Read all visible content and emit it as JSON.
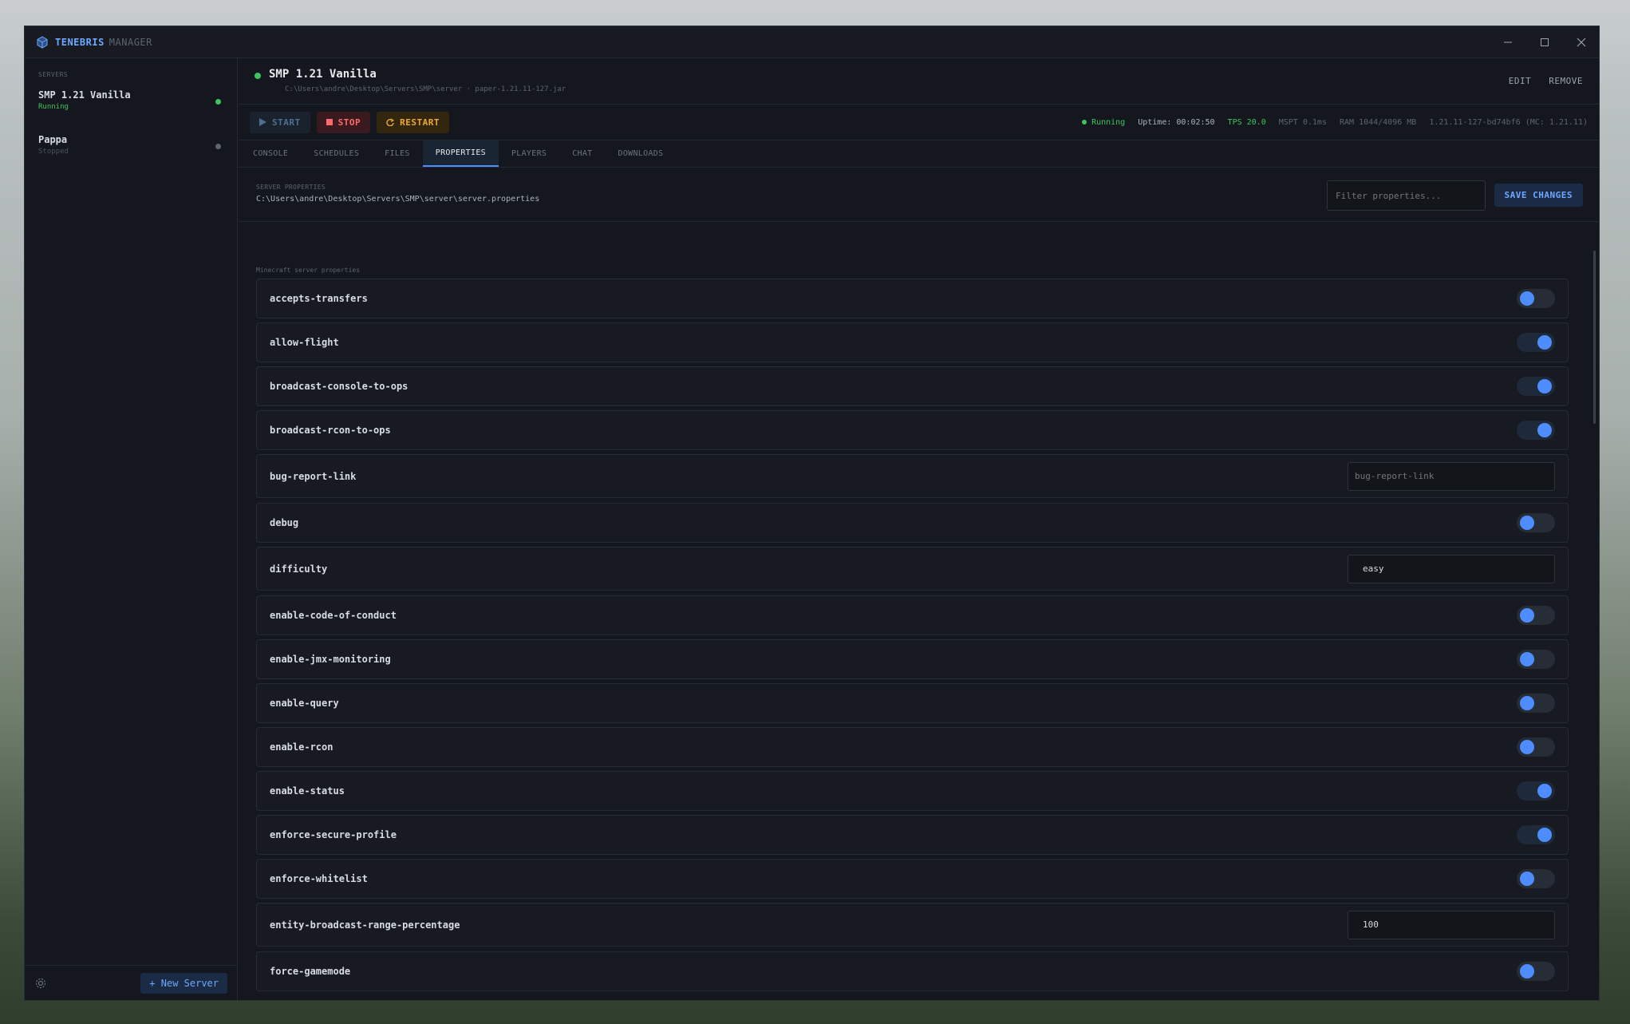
{
  "app": {
    "name": "TENEBRIS",
    "subtitle": "MANAGER"
  },
  "colors": {
    "accent": "#4e8dff",
    "running": "#3ec45f",
    "stopped": "#6b737e",
    "stop": "#ff6a6a",
    "restart": "#f0a830"
  },
  "sidebar": {
    "label": "SERVERS",
    "servers": [
      {
        "name": "SMP 1.21 Vanilla",
        "status": "Running",
        "status_color": "#3ec45f"
      },
      {
        "name": "Pappa",
        "status": "Stopped",
        "status_color": "#5c6470"
      }
    ],
    "new_server_label": "+ New Server"
  },
  "header": {
    "title": "SMP 1.21 Vanilla",
    "path": "C:\\Users\\andre\\Desktop\\Servers\\SMP\\server  ·  paper-1.21.11-127.jar",
    "edit_label": "EDIT",
    "remove_label": "REMOVE"
  },
  "controls": {
    "start_label": "START",
    "stop_label": "STOP",
    "restart_label": "RESTART",
    "status": "Running",
    "uptime": "Uptime: 00:02:50",
    "tps_label": "TPS",
    "tps_value": "20.0",
    "mspt_label": "MSPT",
    "mspt_value": "0.1ms",
    "ram_label": "RAM",
    "ram_value": "1044/4096 MB",
    "version": "1.21.11-127-bd74bf6 (MC: 1.21.11)"
  },
  "tabs": [
    "CONSOLE",
    "SCHEDULES",
    "FILES",
    "PROPERTIES",
    "PLAYERS",
    "CHAT",
    "DOWNLOADS"
  ],
  "properties_header": {
    "label": "SERVER PROPERTIES",
    "path": "C:\\Users\\andre\\Desktop\\Servers\\SMP\\server\\server.properties",
    "filter_placeholder": "Filter properties...",
    "save_label": "SAVE CHANGES"
  },
  "section_label": "Minecraft server properties",
  "properties": [
    {
      "name": "accepts-transfers",
      "type": "toggle",
      "value": false
    },
    {
      "name": "allow-flight",
      "type": "toggle",
      "value": true
    },
    {
      "name": "broadcast-console-to-ops",
      "type": "toggle",
      "value": true
    },
    {
      "name": "broadcast-rcon-to-ops",
      "type": "toggle",
      "value": true
    },
    {
      "name": "bug-report-link",
      "type": "text",
      "value": "",
      "placeholder": "bug-report-link"
    },
    {
      "name": "debug",
      "type": "toggle",
      "value": false
    },
    {
      "name": "difficulty",
      "type": "text",
      "value": "easy"
    },
    {
      "name": "enable-code-of-conduct",
      "type": "toggle",
      "value": false
    },
    {
      "name": "enable-jmx-monitoring",
      "type": "toggle",
      "value": false
    },
    {
      "name": "enable-query",
      "type": "toggle",
      "value": false
    },
    {
      "name": "enable-rcon",
      "type": "toggle",
      "value": false
    },
    {
      "name": "enable-status",
      "type": "toggle",
      "value": true
    },
    {
      "name": "enforce-secure-profile",
      "type": "toggle",
      "value": true
    },
    {
      "name": "enforce-whitelist",
      "type": "toggle",
      "value": false
    },
    {
      "name": "entity-broadcast-range-percentage",
      "type": "text",
      "value": "100"
    },
    {
      "name": "force-gamemode",
      "type": "toggle",
      "value": false
    }
  ]
}
